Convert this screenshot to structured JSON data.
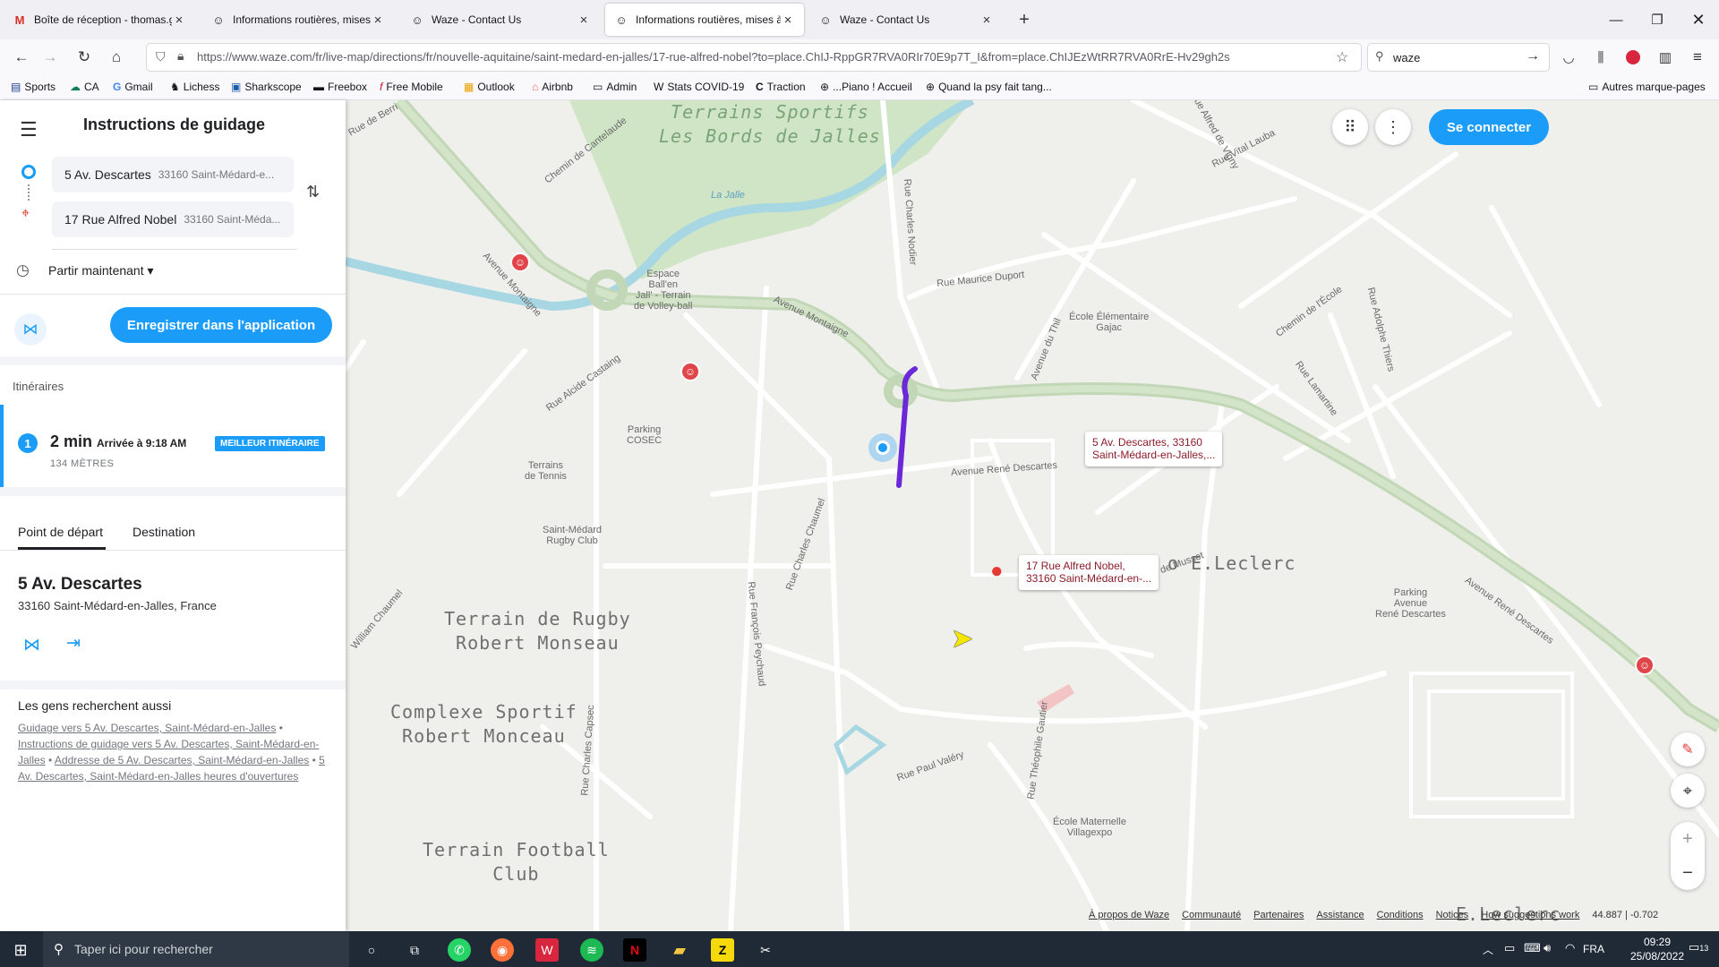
{
  "browser": {
    "tabs": [
      {
        "label": "Boîte de réception - thomas.gu",
        "icon": "gmail-icon"
      },
      {
        "label": "Informations routières, mises à",
        "icon": "waze-icon"
      },
      {
        "label": "Waze - Contact Us",
        "icon": "waze-icon"
      },
      {
        "label": "Informations routières, mises à",
        "icon": "waze-icon",
        "active": true
      },
      {
        "label": "Waze - Contact Us",
        "icon": "waze-icon"
      }
    ],
    "url": "https://www.waze.com/fr/live-map/directions/fr/nouvelle-aquitaine/saint-medard-en-jalles/17-rue-alfred-nobel?to=place.ChIJ-RppGR7RVA0RIr70E9p7T_I&from=place.ChIJEzWtRR7RVA0RrE-Hv29gh2s",
    "search_value": "waze",
    "bookmarks": [
      "Sports",
      "CA",
      "Gmail",
      "Lichess",
      "Sharkscope",
      "Freebox",
      "Free Mobile",
      "Outlook",
      "Airbnb",
      "Admin",
      "Stats COVID-19",
      "Traction",
      "...Piano ! Accueil",
      "Quand la psy fait tang..."
    ],
    "other_bookmarks": "Autres marque-pages"
  },
  "panel": {
    "title": "Instructions de guidage",
    "from_main": "5 Av. Descartes",
    "from_sub": "33160 Saint-Médard-e...",
    "to_main": "17 Rue Alfred Nobel",
    "to_sub": "33160 Saint-Méda...",
    "depart": "Partir maintenant",
    "save_button": "Enregistrer dans l'application",
    "itineraries_label": "Itinéraires",
    "route_index": "1",
    "route_time": "2 min",
    "route_arrival": "Arrivée à 9:18 AM",
    "route_badge": "MEILLEUR ITINÉRAIRE",
    "route_distance": "134 MÈTRES",
    "tab_start": "Point de départ",
    "tab_dest": "Destination",
    "place_name": "5 Av. Descartes",
    "place_address": "33160 Saint-Médard-en-Jalles, France",
    "also_title": "Les gens recherchent aussi",
    "also_links": [
      "Guidage vers 5 Av. Descartes, Saint-Médard-en-Jalles",
      "Instructions de guidage vers 5 Av. Descartes, Saint-Médard-en-Jalles",
      "Addresse de 5 Av. Descartes, Saint-Médard-en-Jalles",
      "5 Av. Descartes, Saint-Médard-en-Jalles heures d'ouvertures"
    ],
    "accent_color": "#1a9cf8"
  },
  "map": {
    "connect_button": "Se connecter",
    "from_tip_1": "5 Av. Descartes, 33160",
    "from_tip_2": "Saint-Médard-en-Jalles,...",
    "to_tip_1": "17 Rue Alfred Nobel,",
    "to_tip_2": "33160 Saint-Médard-en-...",
    "route_color": "#6b28d8",
    "areas": {
      "sports_1": "Terrains Sportifs",
      "sports_2": "Les Bords de Jalles",
      "rugby_1": "Terrain de Rugby",
      "rugby_2": "Robert Monseau",
      "complexe_1": "Complexe Sportif",
      "complexe_2": "Robert Monceau",
      "football_1": "Terrain Football",
      "football_2": "Club",
      "leclerc": "o E.Leclerc",
      "leclerc2": "E.Leclerc"
    },
    "labels": {
      "la_jalle": "La Jalle",
      "espace_1": "Espace",
      "espace_2": "Ball'en",
      "espace_3": "Jall' - Terrain",
      "espace_4": "de Volley-ball",
      "parking_cosec_1": "Parking",
      "parking_cosec_2": "COSEC",
      "tennis_1": "Terrains",
      "tennis_2": "de Tennis",
      "rugbyclub_1": "Saint-Médard",
      "rugbyclub_2": "Rugby Club",
      "ecole_gajac_1": "École Élémentaire",
      "ecole_gajac_2": "Gajac",
      "ecole_villagexpo_1": "École Maternelle",
      "ecole_villagexpo_2": "Villagexpo",
      "parking_rd_1": "Parking",
      "parking_rd_2": "Avenue",
      "parking_rd_3": "René Descartes",
      "av_montaigne": "Avenue Montaigne",
      "av_montaigne2": "Avenue Montaigne",
      "av_rene_descartes": "Avenue René Descartes",
      "av_rene_descartes2": "Avenue René Descartes",
      "rue_maurice_duport": "Rue Maurice Duport",
      "rue_vital_lauba": "Rue Vital Lauba",
      "rue_charles_nodier": "Rue Charles Nodier",
      "chemin_cantelaude": "Chemin de Cantelaude",
      "rue_alcide_castaing": "Rue Alcide Castaing",
      "rue_alfred_musset": "Rue Alfred de Musset",
      "chemin_ecole": "Chemin de l'École",
      "rue_lamartine": "Rue Lamartine",
      "rue_adolphe_thiers": "Rue Adolphe Thiers",
      "avenue_du_thil": "Avenue du Thil",
      "rue_charles_chaumel": "Rue Charles Chaumel",
      "rue_francois_peychaud": "Rue François Peychaud",
      "rue_charles_capsec": "Rue Charles Capsec",
      "william_chaumel": "William Chaumel",
      "rue_paul_valery": "Rue Paul Valéry",
      "rue_theophile_gautier": "Rue Théophile Gautier",
      "rue_alfred_vigny": "Rue Alfred de Vigny",
      "rue_de_berri": "Rue de Berri"
    },
    "footer_links": [
      "À propos de Waze",
      "Communauté",
      "Partenaires",
      "Assistance",
      "Conditions",
      "Notices",
      "How suggestions work"
    ],
    "coords": "44.887 | -0.702"
  },
  "taskbar": {
    "search_placeholder": "Taper ici pour rechercher",
    "lang": "FRA",
    "time": "09:29",
    "date": "25/08/2022",
    "notif": "13"
  }
}
